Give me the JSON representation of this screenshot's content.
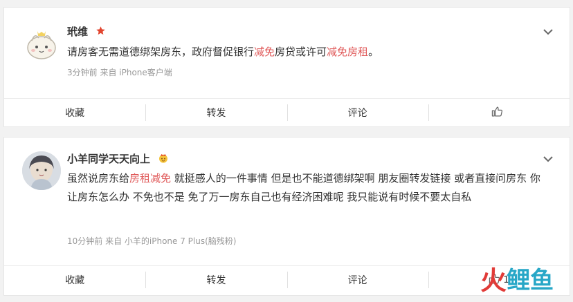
{
  "posts": [
    {
      "username": "玳维",
      "content": [
        {
          "text": "请房客无需道德绑架房东，政府督促银行",
          "highlight": false
        },
        {
          "text": "减免",
          "highlight": true
        },
        {
          "text": "房贷或许可",
          "highlight": false
        },
        {
          "text": "减免房租",
          "highlight": true
        },
        {
          "text": "。",
          "highlight": false
        }
      ],
      "meta": "3分钟前  来自 iPhone客户端",
      "actions": {
        "collect": "收藏",
        "repost": "转发",
        "comment": "评论",
        "like_count": ""
      }
    },
    {
      "username": "小羊同学天天向上",
      "content": [
        {
          "text": "虽然说房东给",
          "highlight": false
        },
        {
          "text": "房租减免",
          "highlight": true
        },
        {
          "text": " 就挺感人的一件事情 但是也不能道德绑架啊 朋友圈转发链接 或者直接问房东 你让房东怎么办 不免也不是 免了万一房东自己也有经济困难呢 我只能说有时候不要太自私",
          "highlight": false
        }
      ],
      "meta": "10分钟前  来自 小羊的iPhone 7 Plus(脑残粉)",
      "actions": {
        "collect": "收藏",
        "repost": "转发",
        "comment": "评论",
        "like_count": "1"
      }
    }
  ],
  "watermark": [
    "火",
    "鲤",
    "鱼"
  ],
  "colors": {
    "highlight": "#e05a5a",
    "accent_badge": "#e2452f",
    "watermark_blue": "#27a7c7",
    "watermark_red": "#e13b38"
  },
  "icons": [
    "star-badge-icon",
    "chevron-down-icon",
    "thumbs-up-icon",
    "crown-emoji-icon"
  ]
}
